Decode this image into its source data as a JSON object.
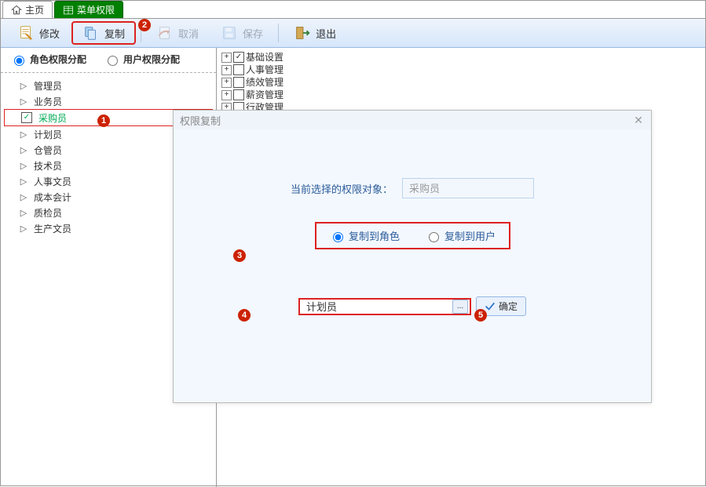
{
  "tabs": {
    "home": "主页",
    "current": "菜单权限"
  },
  "toolbar": {
    "edit": "修改",
    "copy": "复制",
    "cancel": "取消",
    "save": "保存",
    "exit": "退出"
  },
  "leftMode": {
    "byRole": "角色权限分配",
    "byUser": "用户权限分配"
  },
  "roles": [
    "管理员",
    "业务员",
    "采购员",
    "计划员",
    "仓管员",
    "技术员",
    "人事文员",
    "成本会计",
    "质检员",
    "生产文员"
  ],
  "selectedRoleIndex": 2,
  "permTree": [
    {
      "label": "基础设置",
      "checked": true
    },
    {
      "label": "人事管理",
      "checked": false
    },
    {
      "label": "绩效管理",
      "checked": false
    },
    {
      "label": "薪资管理",
      "checked": false
    },
    {
      "label": "行政管理",
      "checked": false
    }
  ],
  "dialog": {
    "title": "权限复制",
    "currentLabel": "当前选择的权限对象：",
    "currentValue": "采购员",
    "copyToRole": "复制到角色",
    "copyToUser": "复制到用户",
    "targetValue": "计划员",
    "ok": "确定"
  },
  "markers": {
    "m1": "1",
    "m2": "2",
    "m3": "3",
    "m4": "4",
    "m5": "5"
  }
}
